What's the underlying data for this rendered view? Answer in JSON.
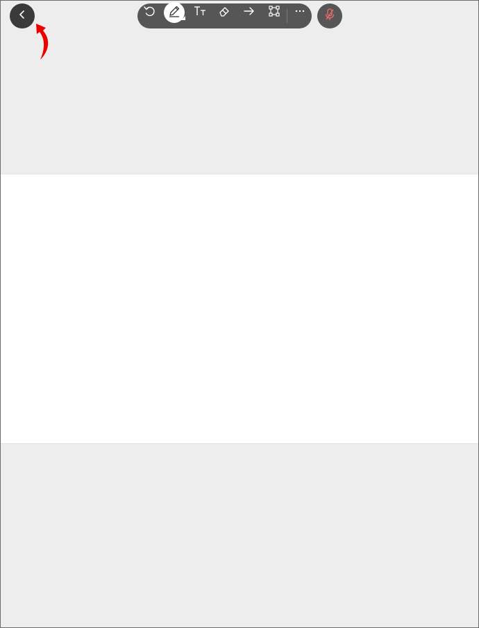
{
  "toolbar": {
    "tools": [
      {
        "name": "undo",
        "icon": "undo-icon"
      },
      {
        "name": "pen",
        "icon": "pen-icon",
        "active": true
      },
      {
        "name": "text",
        "icon": "text-size-icon"
      },
      {
        "name": "eraser",
        "icon": "eraser-icon"
      },
      {
        "name": "arrow",
        "icon": "arrow-right-icon"
      },
      {
        "name": "selection",
        "icon": "selection-box-icon"
      },
      {
        "name": "more",
        "icon": "more-icon"
      }
    ]
  },
  "navigation": {
    "back_icon": "chevron-left-icon"
  },
  "microphone": {
    "icon": "microphone-muted-icon",
    "color": "#f26b6b"
  },
  "annotation": {
    "arrow_color": "#ee0000"
  },
  "colors": {
    "canvas_background": "#ededed",
    "page_background": "#ffffff",
    "toolbar_background": "#565656",
    "back_button_background": "#3a3a3a"
  }
}
